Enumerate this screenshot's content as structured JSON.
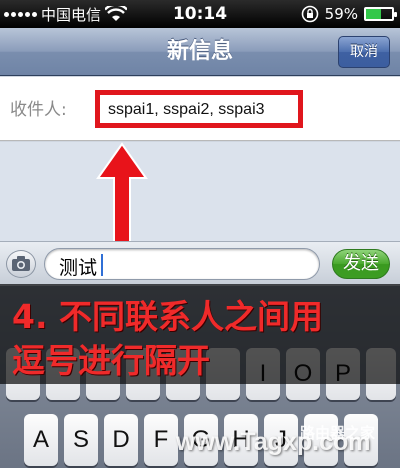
{
  "status_bar": {
    "carrier": "中国电信",
    "time": "10:14",
    "battery": "59%"
  },
  "navbar": {
    "title": "新信息",
    "cancel_label": "取消"
  },
  "recipient": {
    "label": "收件人:",
    "value": "sspai1, sspai2, sspai3"
  },
  "compose": {
    "text": "测试",
    "send_label": "发送"
  },
  "keyboard": {
    "row1": [
      "I",
      "O",
      "P"
    ],
    "row2": [
      "A",
      "S",
      "D",
      "F",
      "G",
      "H",
      "J"
    ]
  },
  "caption": {
    "line1": "4. 不同联系人之间用",
    "line2": "逗号进行隔开"
  },
  "watermark": {
    "text": "www.Tagxp.com",
    "text_cn": "路由器之家"
  },
  "colors": {
    "highlight_red": "#e0161d",
    "send_green": "#4aa82e",
    "nav_blue": "#8a9cba"
  }
}
